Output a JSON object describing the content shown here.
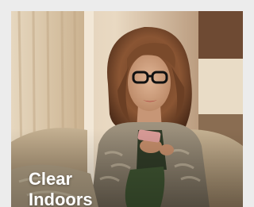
{
  "tile": {
    "caption_line1": "Clear",
    "caption_line2": "Indoors"
  },
  "image": {
    "subject": "woman-with-glasses-reading-phone-icon"
  }
}
